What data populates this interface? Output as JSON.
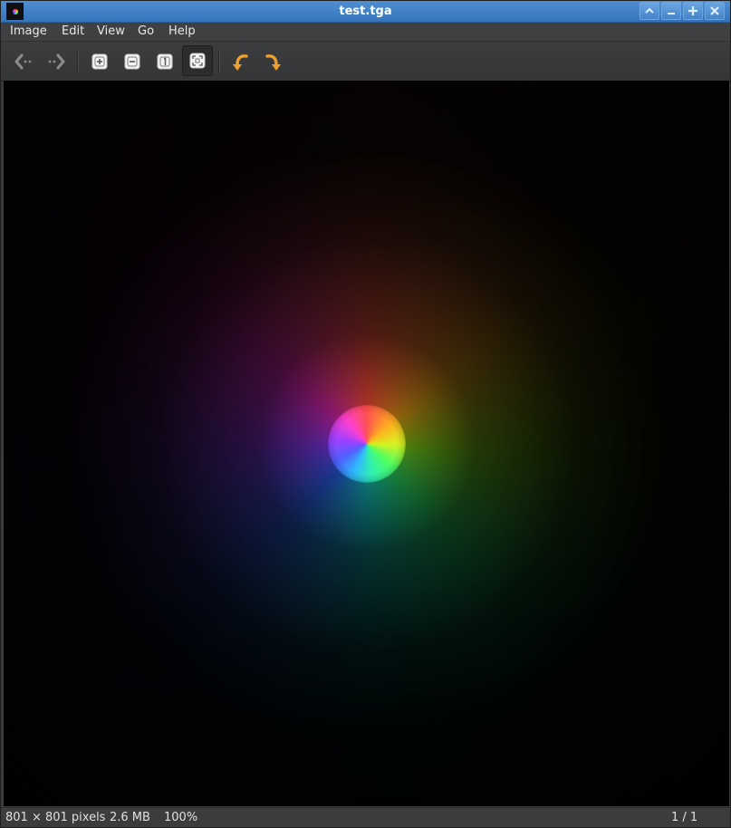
{
  "window": {
    "title": "test.tga"
  },
  "menu": {
    "items": [
      "Image",
      "Edit",
      "View",
      "Go",
      "Help"
    ]
  },
  "toolbar": {
    "tools": [
      "back-icon",
      "forward-icon",
      "zoom-in-icon",
      "zoom-out-icon",
      "zoom-original-icon",
      "zoom-fit-icon",
      "rotate-left-icon",
      "rotate-right-icon"
    ],
    "active_tool": "zoom-fit-icon"
  },
  "status": {
    "dimensions": "801 × 801 pixels",
    "file_size": "2.6 MB",
    "zoom": "100%",
    "page": "1 / 1"
  },
  "colors": {
    "titlebar": "#3474bb",
    "background": "#393b3d",
    "accent_orange": "#f0a030"
  }
}
